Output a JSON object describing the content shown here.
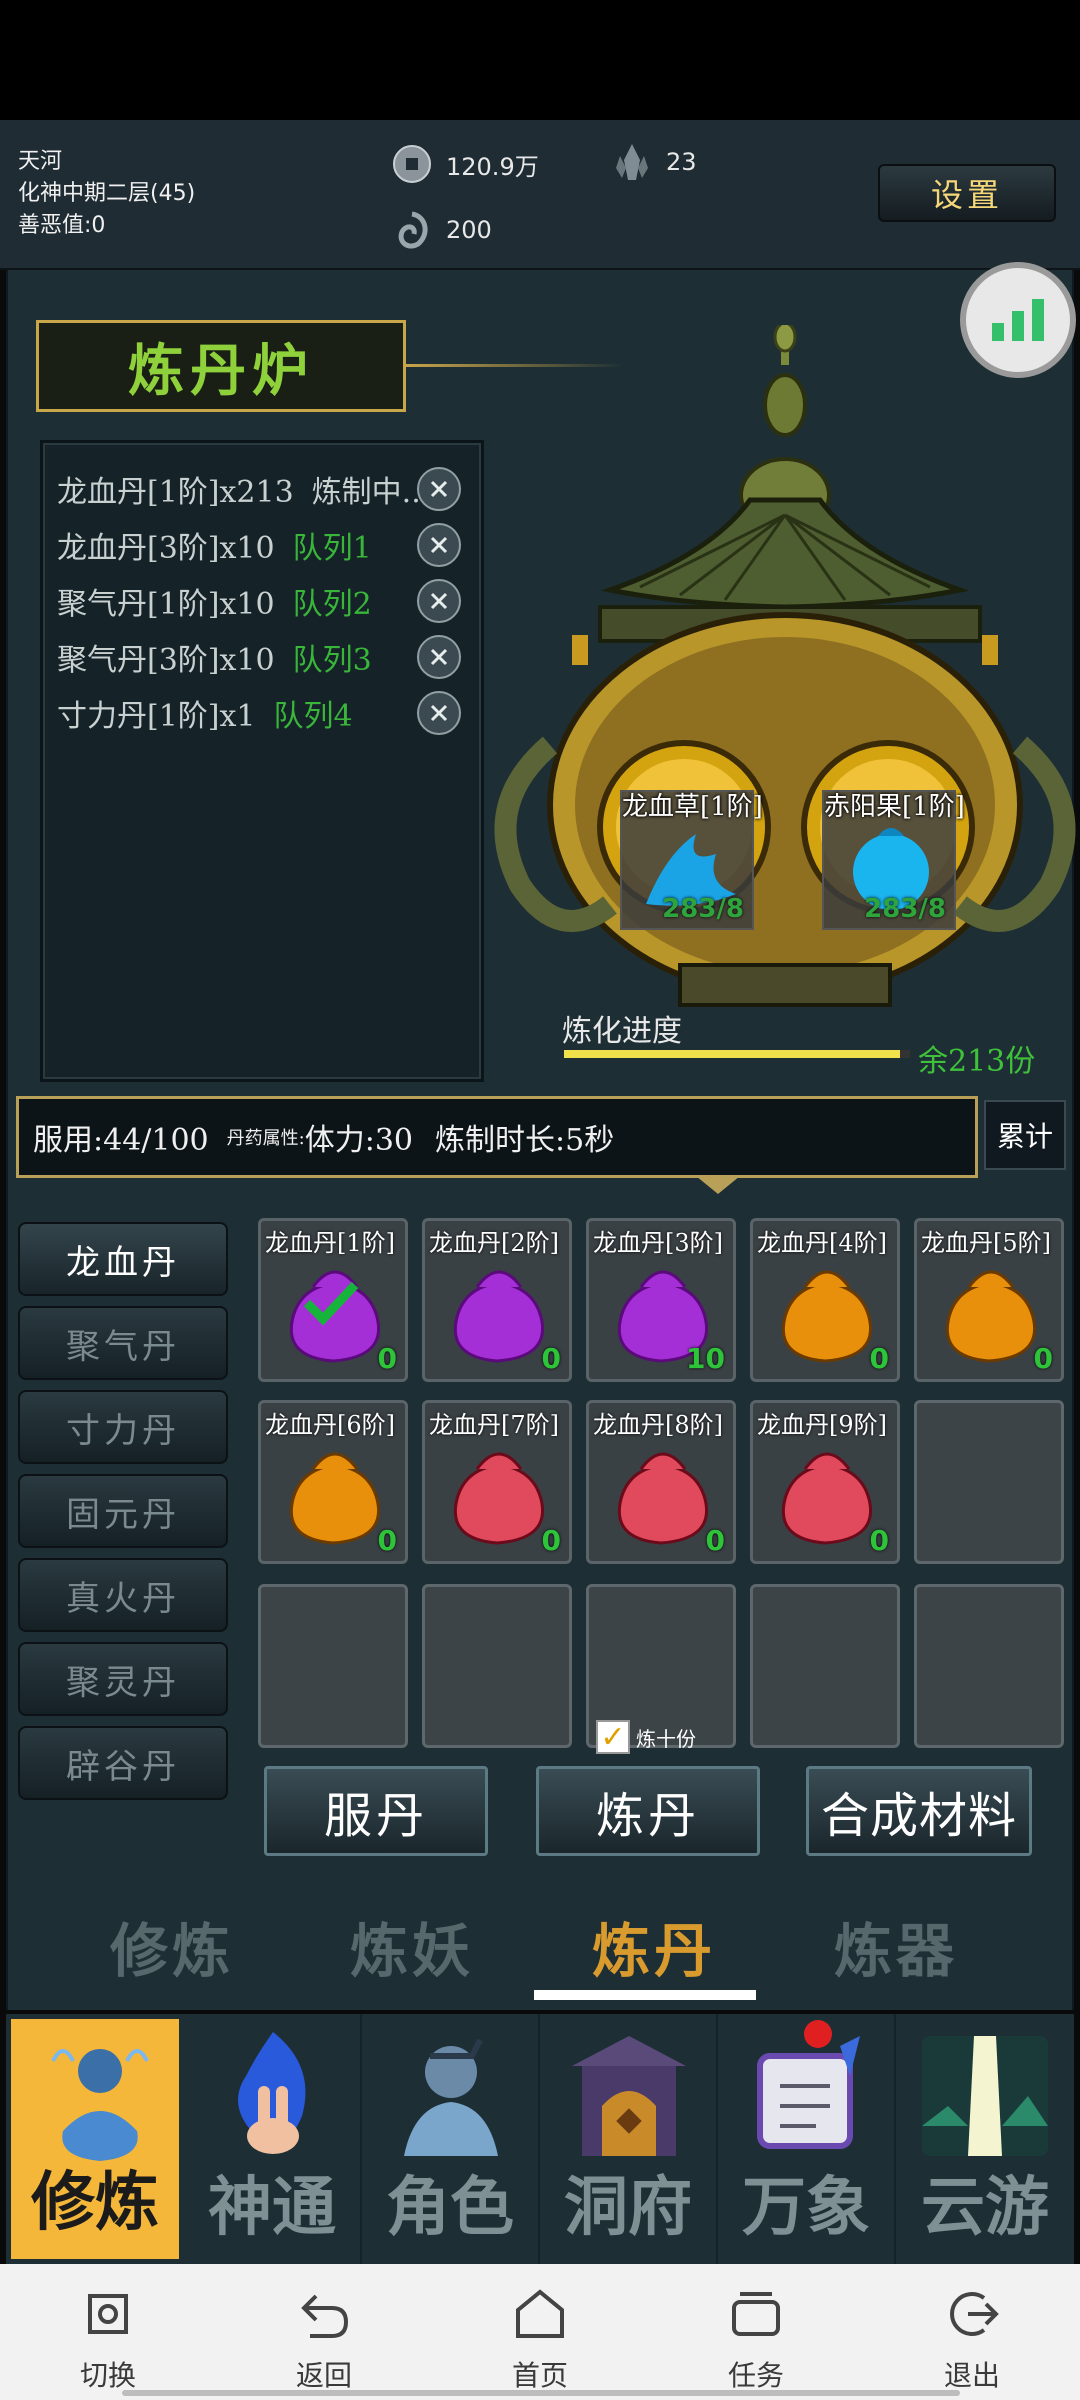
{
  "player": {
    "name": "天河",
    "realm": "化神中期二层(45)",
    "karma": "善恶值:0"
  },
  "currencies": {
    "coins": "120.9万",
    "crystals": "23",
    "spirit": "200"
  },
  "header": {
    "settings_label": "设置"
  },
  "furnace": {
    "title": "炼丹炉"
  },
  "queue": [
    {
      "item": "龙血丹[1阶]x213",
      "status": "炼制中...",
      "status_color": "#c8d0d0"
    },
    {
      "item": "龙血丹[3阶]x10",
      "status": "队列1",
      "status_color": "#39b53a"
    },
    {
      "item": "聚气丹[1阶]x10",
      "status": "队列2",
      "status_color": "#39b53a"
    },
    {
      "item": "聚气丹[3阶]x10",
      "status": "队列3",
      "status_color": "#39b53a"
    },
    {
      "item": "寸力丹[1阶]x1",
      "status": "队列4",
      "status_color": "#39b53a"
    }
  ],
  "ingredients": [
    {
      "name": "龙血草[1阶]",
      "count": "283/8",
      "icon": "blue-herb-icon"
    },
    {
      "name": "赤阳果[1阶]",
      "count": "283/8",
      "icon": "blue-fruit-icon"
    }
  ],
  "progress": {
    "label": "炼化进度",
    "remaining": "余213份",
    "fraction": 0.97
  },
  "info": {
    "dose": "服用:44/100",
    "attr_label": "丹药属性:",
    "attr_value": "体力:30",
    "duration": "炼制时长:5秒",
    "cumulative_label": "累计"
  },
  "categories": [
    {
      "label": "龙血丹",
      "active": true
    },
    {
      "label": "聚气丹",
      "active": false
    },
    {
      "label": "寸力丹",
      "active": false
    },
    {
      "label": "固元丹",
      "active": false
    },
    {
      "label": "真火丹",
      "active": false
    },
    {
      "label": "聚灵丹",
      "active": false
    },
    {
      "label": "辟谷丹",
      "active": false
    }
  ],
  "pills": [
    {
      "name": "龙血丹[1阶]",
      "count": "0",
      "color": "#a42fd6",
      "selected": true
    },
    {
      "name": "龙血丹[2阶]",
      "count": "0",
      "color": "#a42fd6",
      "selected": false
    },
    {
      "name": "龙血丹[3阶]",
      "count": "10",
      "color": "#a42fd6",
      "selected": false
    },
    {
      "name": "龙血丹[4阶]",
      "count": "0",
      "color": "#e8900c",
      "selected": false
    },
    {
      "name": "龙血丹[5阶]",
      "count": "0",
      "color": "#e8900c",
      "selected": false
    },
    {
      "name": "龙血丹[6阶]",
      "count": "0",
      "color": "#e8900c",
      "selected": false
    },
    {
      "name": "龙血丹[7阶]",
      "count": "0",
      "color": "#e04a5c",
      "selected": false
    },
    {
      "name": "龙血丹[8阶]",
      "count": "0",
      "color": "#e04a5c",
      "selected": false
    },
    {
      "name": "龙血丹[9阶]",
      "count": "0",
      "color": "#e04a5c",
      "selected": false
    }
  ],
  "ten_portions": {
    "label": "炼十份",
    "checked": true
  },
  "actions": {
    "take": "服丹",
    "refine": "炼丹",
    "synthesize": "合成材料"
  },
  "sub_tabs": [
    {
      "label": "修炼",
      "active": false
    },
    {
      "label": "炼妖",
      "active": false
    },
    {
      "label": "炼丹",
      "active": true
    },
    {
      "label": "炼器",
      "active": false
    }
  ],
  "bottom_nav": [
    {
      "label": "修炼",
      "icon": "meditating-monk-icon",
      "active": true,
      "badge": false
    },
    {
      "label": "神通",
      "icon": "flame-hand-icon",
      "active": false,
      "badge": false
    },
    {
      "label": "角色",
      "icon": "warrior-bust-icon",
      "active": false,
      "badge": false
    },
    {
      "label": "洞府",
      "icon": "cave-gate-icon",
      "active": false,
      "badge": false
    },
    {
      "label": "万象",
      "icon": "scroll-quill-icon",
      "active": false,
      "badge": true
    },
    {
      "label": "云游",
      "icon": "waterfall-landscape-icon",
      "active": false,
      "badge": false
    }
  ],
  "system_nav": [
    {
      "label": "切换",
      "icon": "switch-icon"
    },
    {
      "label": "返回",
      "icon": "back-arrow-icon"
    },
    {
      "label": "首页",
      "icon": "home-icon"
    },
    {
      "label": "任务",
      "icon": "tasks-icon"
    },
    {
      "label": "退出",
      "icon": "exit-icon"
    }
  ],
  "colors": {
    "accent_gold": "#f4b73a",
    "count_green": "#2ec43a",
    "panel_bg": "#1d2f35"
  }
}
